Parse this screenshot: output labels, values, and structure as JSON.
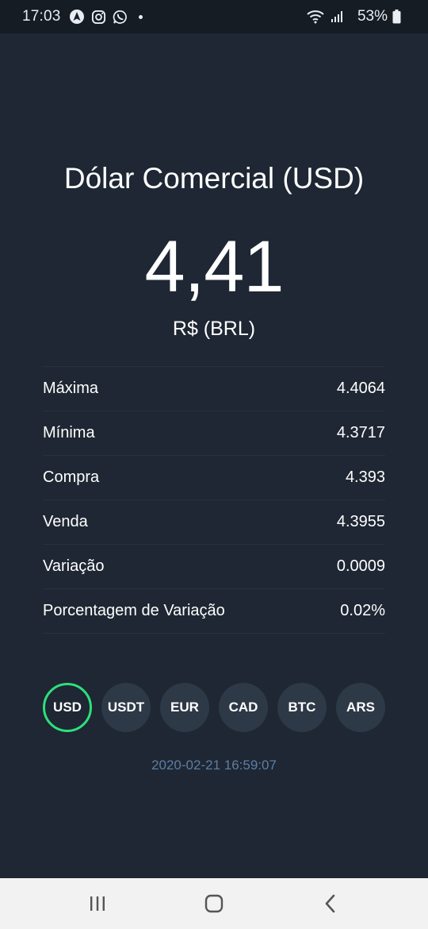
{
  "status_bar": {
    "time": "17:03",
    "battery": "53%",
    "notification_icons": [
      "navigation-icon",
      "instagram-icon",
      "whatsapp-icon"
    ]
  },
  "main": {
    "title": "Dólar Comercial (USD)",
    "rate": "4,41",
    "currency": "R$ (BRL)",
    "details": [
      {
        "label": "Máxima",
        "value": "4.4064"
      },
      {
        "label": "Mínima",
        "value": "4.3717"
      },
      {
        "label": "Compra",
        "value": "4.393"
      },
      {
        "label": "Venda",
        "value": "4.3955"
      },
      {
        "label": "Variação",
        "value": "0.0009"
      },
      {
        "label": "Porcentagem de Variação",
        "value": "0.02%"
      }
    ],
    "currencies": [
      {
        "label": "USD",
        "active": true
      },
      {
        "label": "USDT",
        "active": false
      },
      {
        "label": "EUR",
        "active": false
      },
      {
        "label": "CAD",
        "active": false
      },
      {
        "label": "BTC",
        "active": false
      },
      {
        "label": "ARS",
        "active": false
      }
    ],
    "timestamp": "2020-02-21 16:59:07"
  },
  "colors": {
    "background": "#1e2733",
    "status_bar": "#161c24",
    "button": "#2e3947",
    "active_ring": "#2ee07a",
    "timestamp": "#5d7ea6"
  }
}
